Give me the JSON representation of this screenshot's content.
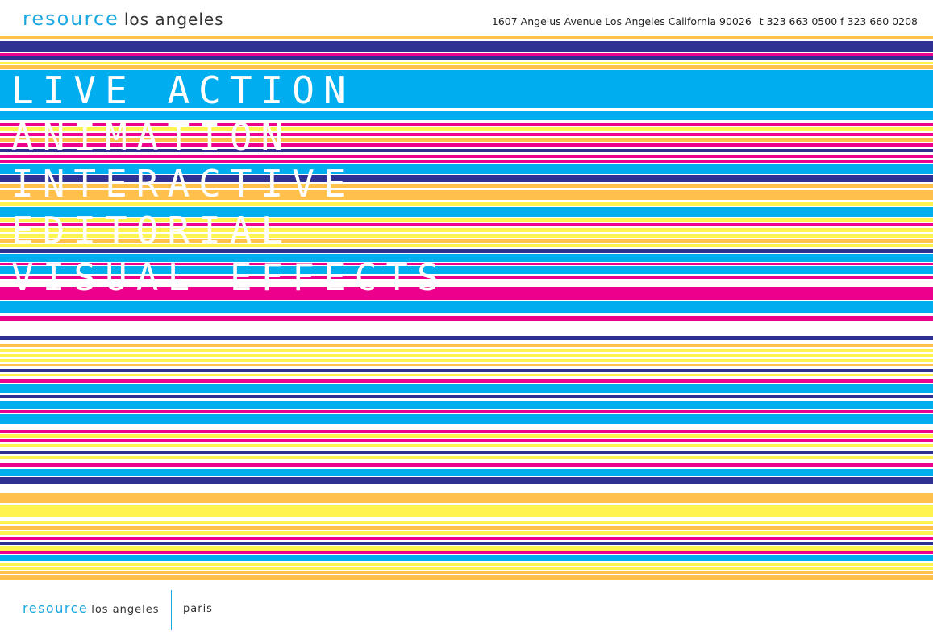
{
  "header": {
    "brand": "resource",
    "city": "los angeles",
    "address": "1607 Angelus Avenue Los Angeles California 90026",
    "phone": "t 323 663 0500",
    "fax": "f 323 660 0208"
  },
  "menu": {
    "items": [
      {
        "label": "LIVE ACTION"
      },
      {
        "label": "ANIMATION"
      },
      {
        "label": "INTERACTIVE"
      },
      {
        "label": "EDITORIAL"
      },
      {
        "label": "VISUAL EFFECTS"
      }
    ]
  },
  "footer": {
    "brand": "resource",
    "city": "los angeles",
    "alt_city": "paris"
  },
  "colors": {
    "cyan": "#00aeef",
    "magenta": "#ec008c",
    "navy": "#2e3192",
    "orange": "#ffc04c",
    "yellow": "#fff44f",
    "brand_text": "#1ba8e0"
  }
}
